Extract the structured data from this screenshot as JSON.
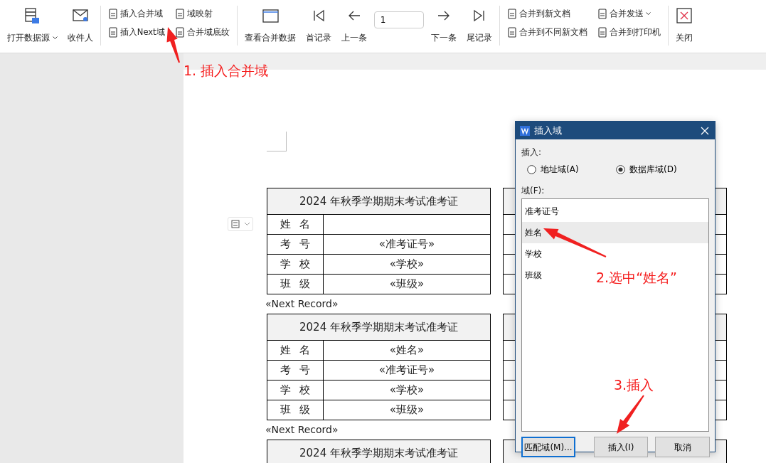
{
  "toolbar": {
    "groups": [
      {
        "items": [
          {
            "kind": "large",
            "label": "打开数据源",
            "dropdown": true
          },
          {
            "kind": "large",
            "label": "收件人",
            "dropdown": false
          }
        ]
      },
      {
        "items": [
          {
            "kind": "stack",
            "rows": [
              {
                "label": "插入合并域",
                "dropdown": false
              },
              {
                "label": "插入Next域",
                "dropdown": false
              }
            ]
          },
          {
            "kind": "stack",
            "rows": [
              {
                "label": "域映射",
                "dropdown": false
              },
              {
                "label": "合并域底纹",
                "dropdown": false
              }
            ]
          }
        ]
      },
      {
        "items": [
          {
            "kind": "large",
            "label": "查看合并数据",
            "dropdown": false
          },
          {
            "kind": "large",
            "label": "首记录",
            "dropdown": false
          },
          {
            "kind": "large",
            "label": "上一条",
            "dropdown": false
          },
          {
            "kind": "field",
            "value": "1"
          },
          {
            "kind": "large",
            "label": "下一条",
            "dropdown": false
          },
          {
            "kind": "large",
            "label": "尾记录",
            "dropdown": false
          }
        ]
      },
      {
        "items": [
          {
            "kind": "stack",
            "rows": [
              {
                "label": "合并到新文档",
                "dropdown": false
              },
              {
                "label": "合并到不同新文档",
                "dropdown": false
              }
            ]
          },
          {
            "kind": "stack",
            "rows": [
              {
                "label": "合并发送",
                "dropdown": true
              },
              {
                "label": "合并到打印机",
                "dropdown": false
              }
            ]
          }
        ]
      },
      {
        "items": [
          {
            "kind": "large",
            "label": "关闭",
            "dropdown": false
          }
        ]
      }
    ]
  },
  "document": {
    "cards": [
      {
        "title": "2024 年秋季学期期末考试准考证",
        "rows": [
          {
            "label": "姓 名"
          },
          {
            "label": "考 号",
            "value": "«准考证号»"
          },
          {
            "label": "学 校",
            "value": "«学校»"
          },
          {
            "label": "班 级",
            "value": "«班级»"
          }
        ],
        "next_record": "«Next Record»"
      },
      {
        "title": "2024 年秋季学期期末考试准考证",
        "rows": [
          {
            "label": "姓 名",
            "value": "«姓名»"
          },
          {
            "label": "考 号",
            "value": "«准考证号»"
          },
          {
            "label": "学 校",
            "value": "«学校»"
          },
          {
            "label": "班 级",
            "value": "«班级»"
          }
        ],
        "next_record": "«Next Record»"
      },
      {
        "title": "2024 年秋季学期期末考试准考证"
      }
    ]
  },
  "dialog": {
    "title": "插入域",
    "insert_label": "插入:",
    "options": [
      {
        "label": "地址域(A)",
        "selected": false
      },
      {
        "label": "数据库域(D)",
        "selected": true
      }
    ],
    "fields_label": "域(F):",
    "fields": [
      {
        "label": "准考证号",
        "selected": false
      },
      {
        "label": "姓名",
        "selected": true
      },
      {
        "label": "学校",
        "selected": false
      },
      {
        "label": "班级",
        "selected": false
      }
    ],
    "buttons": [
      {
        "label": "匹配域(M)...",
        "focused": true
      },
      {
        "label": "插入(I)",
        "focused": false
      },
      {
        "label": "取消",
        "focused": false
      }
    ]
  },
  "annotations": [
    {
      "text": "1. 插入合并域"
    },
    {
      "text": "2.选中“姓名”"
    },
    {
      "text": "3.插入"
    }
  ]
}
